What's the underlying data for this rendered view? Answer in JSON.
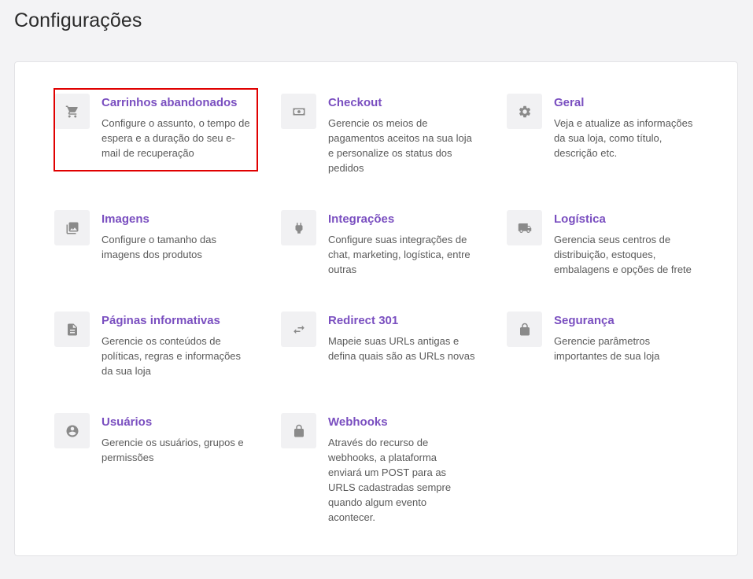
{
  "page": {
    "title": "Configurações"
  },
  "colors": {
    "accent": "#7a4fc0",
    "highlight": "#e00000",
    "icon": "#8a8a8a"
  },
  "items": [
    {
      "title": "Carrinhos abandonados",
      "desc": "Configure o assunto, o tempo de espera e a duração do seu e-mail de recuperação",
      "icon": "cart-icon"
    },
    {
      "title": "Checkout",
      "desc": "Gerencie os meios de pagamentos aceitos na sua loja e personalize os status dos pedidos",
      "icon": "money-icon"
    },
    {
      "title": "Geral",
      "desc": "Veja e atualize as informações da sua loja, como título, descrição etc.",
      "icon": "gear-icon"
    },
    {
      "title": "Imagens",
      "desc": "Configure o tamanho das imagens dos produtos",
      "icon": "images-icon"
    },
    {
      "title": "Integrações",
      "desc": "Configure suas integrações de chat, marketing, logística, entre outras",
      "icon": "plug-icon"
    },
    {
      "title": "Logística",
      "desc": "Gerencia seus centros de distribuição, estoques, embalagens e opções de frete",
      "icon": "truck-icon"
    },
    {
      "title": "Páginas informativas",
      "desc": "Gerencie os conteúdos de políticas, regras e informações da sua loja",
      "icon": "document-icon"
    },
    {
      "title": "Redirect 301",
      "desc": "Mapeie suas URLs antigas e defina quais são as URLs novas",
      "icon": "swap-arrows-icon"
    },
    {
      "title": "Segurança",
      "desc": "Gerencie parâmetros importantes de sua loja",
      "icon": "lock-icon"
    },
    {
      "title": "Usuários",
      "desc": "Gerencie os usuários, grupos e permissões",
      "icon": "user-circle-icon"
    },
    {
      "title": "Webhooks",
      "desc": "Através do recurso de webhooks, a plataforma enviará um POST para as URLS cadastradas sempre quando algum evento acontecer.",
      "icon": "lock-icon"
    }
  ]
}
